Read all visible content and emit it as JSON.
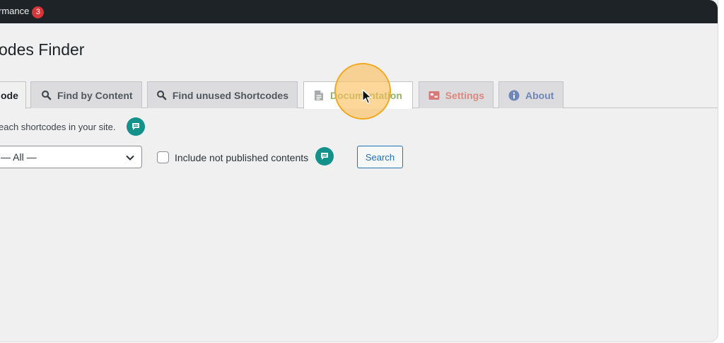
{
  "admin_bar": {
    "menu_text": "rmance",
    "badge_count": "3"
  },
  "page": {
    "title": "odes Finder"
  },
  "tabs": [
    {
      "label": "ode",
      "icon": "none",
      "state": "active"
    },
    {
      "label": "Find by Content",
      "icon": "search-icon",
      "state": "inactive"
    },
    {
      "label": "Find unused Shortcodes",
      "icon": "search-icon",
      "state": "inactive"
    },
    {
      "label": "Documentation",
      "icon": "document-icon",
      "state": "hovered"
    },
    {
      "label": "Settings",
      "icon": "settings-icon",
      "state": "inactive"
    },
    {
      "label": "About",
      "icon": "info-icon",
      "state": "inactive"
    }
  ],
  "description": "each shortcodes in your site.",
  "filters": {
    "post_type_select": "— All —",
    "include_unpublished_label": "Include not published contents",
    "include_unpublished_checked": false,
    "search_button": "Search"
  },
  "colors": {
    "admin_bar": "#1d2327",
    "badge": "#d63638",
    "help_bubble": "#12928b",
    "primary_blue": "#2271b1",
    "documentation_tab_text": "#8fb36b",
    "settings_tab_accent": "#d97a7a",
    "about_tab_accent": "#6f87b7",
    "cursor_halo": "#fcbe5a"
  }
}
